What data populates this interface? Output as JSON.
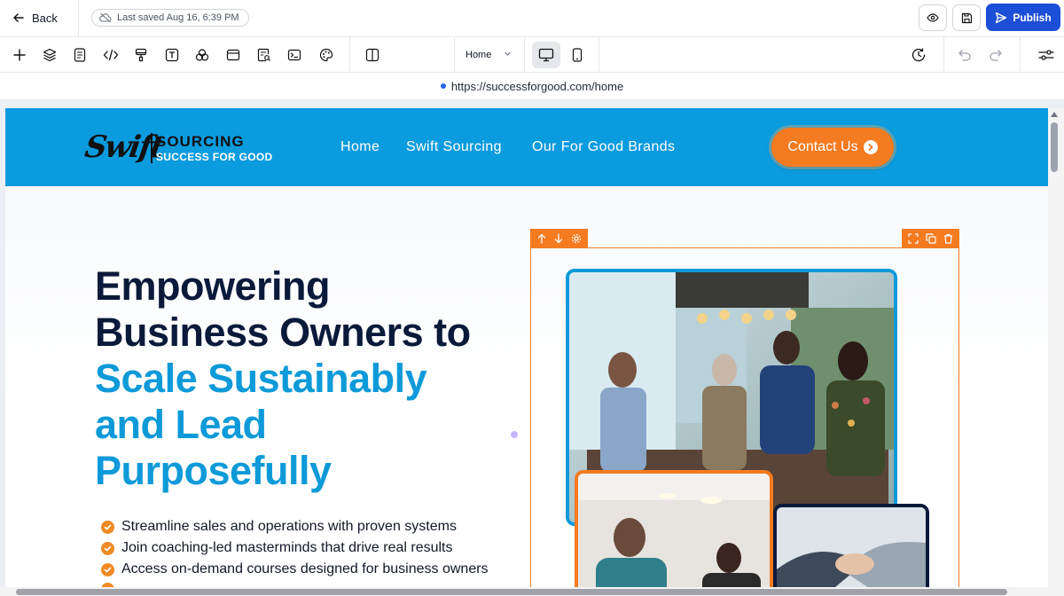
{
  "topbar": {
    "back_label": "Back",
    "saved_status": "Last saved Aug 16, 6:39 PM",
    "publish_label": "Publish"
  },
  "toolbar": {
    "tools": [
      "add-icon",
      "layers-icon",
      "pages-icon",
      "code-icon",
      "paint-icon",
      "text-icon",
      "shapes-icon",
      "section-icon",
      "form-icon",
      "terminal-icon",
      "palette-icon",
      "split-view-icon"
    ],
    "page_select": "Home",
    "devices": [
      "desktop-icon",
      "mobile-icon"
    ],
    "right_tools": [
      "history-icon",
      "undo-icon",
      "redo-icon",
      "settings-sliders-icon"
    ]
  },
  "url": {
    "address": "https://successforgood.com/home"
  },
  "site": {
    "logo": {
      "swift": "Swift",
      "sourcing": "SOURCING",
      "tagline": "SUCCESS FOR GOOD"
    },
    "nav": [
      "Home",
      "Swift Sourcing",
      "Our For Good Brands"
    ],
    "cta_label": "Contact Us",
    "hero": {
      "line1": "Empowering",
      "line2": "Business Owners to",
      "line3": "Scale Sustainably",
      "line4": "and Lead",
      "line5": "Purposefully"
    },
    "bullets": [
      "Streamline sales and operations with proven systems",
      "Join coaching-led masterminds that drive real results",
      "Access on-demand courses designed for business owners"
    ]
  },
  "colors": {
    "header_blue": "#0b9bdf",
    "accent_orange": "#f47b20",
    "publish_blue": "#1d4ed8",
    "heading_dark": "#0b1a3a",
    "heading_blue": "#0e9ad9"
  }
}
